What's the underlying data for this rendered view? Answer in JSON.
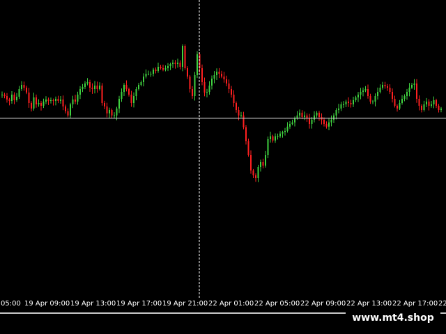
{
  "colors": {
    "background": "#000000",
    "bull": "#3fd13f",
    "bear": "#ff2020",
    "crosshair": "#ffffff",
    "hline": "#c8c8c8"
  },
  "time_axis": {
    "labels": [
      {
        "text": "05:00"
      },
      {
        "text": "19 Apr 09:00"
      },
      {
        "text": "19 Apr 13:00"
      },
      {
        "text": "19 Apr 17:00"
      },
      {
        "text": "19 Apr 21:00"
      },
      {
        "text": "22 Apr 01:00"
      },
      {
        "text": "22 Apr 05:00"
      },
      {
        "text": "22 Apr 09:00"
      },
      {
        "text": "22 Apr 13:00"
      },
      {
        "text": "22 Apr 17:00"
      },
      {
        "text": "22"
      }
    ]
  },
  "watermark": "www.mt4.shop",
  "chart_data": {
    "type": "candlestick",
    "series_price": [
      292,
      290,
      285,
      283,
      292,
      284,
      289,
      300,
      306,
      302,
      295,
      280,
      272,
      288,
      278,
      280,
      276,
      282,
      285,
      283,
      284,
      283,
      286,
      283,
      285,
      275,
      268,
      262,
      278,
      285,
      282,
      292,
      300,
      303,
      308,
      310,
      302,
      300,
      305,
      300,
      305,
      280,
      275,
      265,
      270,
      262,
      262,
      272,
      286,
      296,
      306,
      300,
      292,
      280,
      290,
      300,
      306,
      310,
      318,
      322,
      322,
      322,
      328,
      326,
      332,
      330,
      328,
      330,
      333,
      336,
      338,
      336,
      338,
      332,
      362,
      330,
      318,
      300,
      290,
      320,
      350,
      330,
      310,
      295,
      296,
      305,
      315,
      320,
      325,
      322,
      318,
      314,
      308,
      300,
      292,
      280,
      270,
      262,
      262,
      245,
      225,
      205,
      183,
      176,
      172,
      188,
      195,
      190,
      205,
      228,
      232,
      226,
      232,
      232,
      236,
      238,
      240,
      246,
      250,
      252,
      258,
      262,
      266,
      260,
      262,
      258,
      250,
      256,
      262,
      266,
      260,
      256,
      250,
      246,
      252,
      256,
      262,
      270,
      272,
      278,
      278,
      282,
      280,
      278,
      284,
      288,
      292,
      296,
      298,
      300,
      290,
      282,
      282,
      290,
      296,
      302,
      306,
      304,
      302,
      296,
      286,
      276,
      272,
      280,
      286,
      290,
      296,
      302,
      306,
      308,
      286,
      276,
      270,
      278,
      282,
      276,
      278,
      284,
      276,
      270,
      272
    ],
    "horizontal_level": 258,
    "crosshair_time_index": 95
  }
}
